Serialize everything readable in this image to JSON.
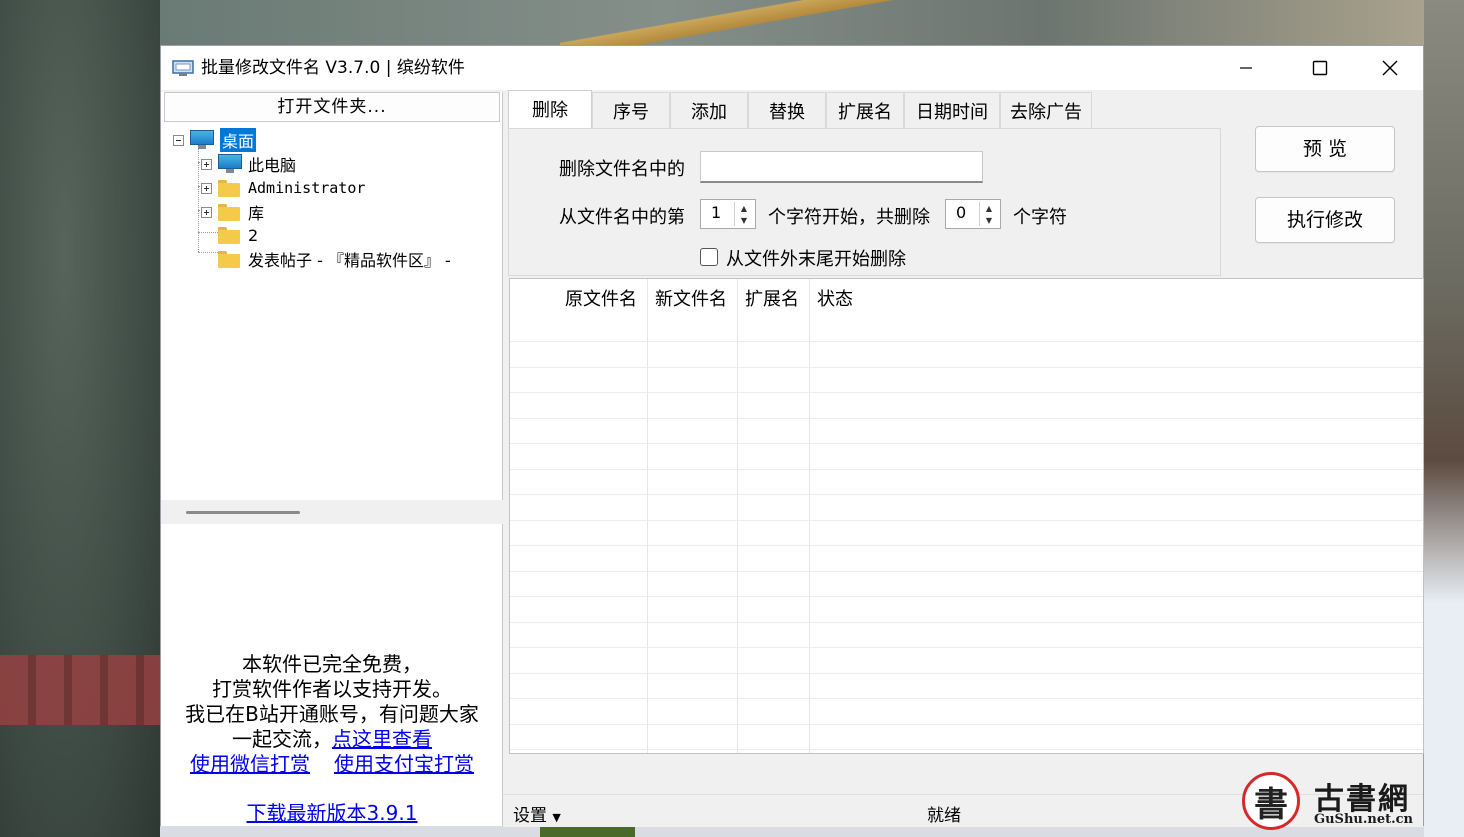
{
  "window": {
    "title": "批量修改文件名 V3.7.0 | 缤纷软件"
  },
  "left_panel": {
    "open_folder_label": "打开文件夹...",
    "tree": [
      {
        "label": "桌面",
        "icon": "monitor-icon",
        "selected": true
      },
      {
        "label": "此电脑",
        "icon": "monitor-icon"
      },
      {
        "label": "Administrator",
        "icon": "folder-icon"
      },
      {
        "label": "库",
        "icon": "folder-icon"
      },
      {
        "label": "2",
        "icon": "folder-icon"
      },
      {
        "label": "发表帖子 - 『精品软件区』 -",
        "icon": "folder-icon"
      }
    ],
    "info": {
      "line1": "本软件已完全免费，",
      "line2": "打赏软件作者以支持开发。",
      "line3": "我已在B站开通账号，有问题大家",
      "line4_prefix": "一起交流，",
      "line4_link": "点这里查看",
      "wechat_link": "使用微信打赏",
      "alipay_link": "使用支付宝打赏",
      "download_link": "下载最新版本3.9.1"
    }
  },
  "tabs": [
    "删除",
    "序号",
    "添加",
    "替换",
    "扩展名",
    "日期时间",
    "去除广告"
  ],
  "delete_panel": {
    "label_delete_in_name": "删除文件名中的",
    "delete_text_value": "",
    "label_from_position": "从文件名中的第",
    "start_position": "1",
    "label_chars_start": "个字符开始，共删除",
    "delete_count": "0",
    "label_chars": "个字符",
    "from_end_label": "从文件外末尾开始删除",
    "from_end_checked": false
  },
  "buttons": {
    "preview": "预  览",
    "execute": "执行修改"
  },
  "list": {
    "columns": [
      "原文件名",
      "新文件名",
      "扩展名",
      "状态"
    ],
    "rows": []
  },
  "statusbar": {
    "settings": "设置",
    "status": "就绪"
  },
  "watermark": {
    "seal_char": "書",
    "title": "古書網",
    "domain": "GuShu.net.cn"
  },
  "colors": {
    "selection": "#0078d7",
    "link": "#0000ee",
    "window_bg": "#f0f0f0"
  }
}
